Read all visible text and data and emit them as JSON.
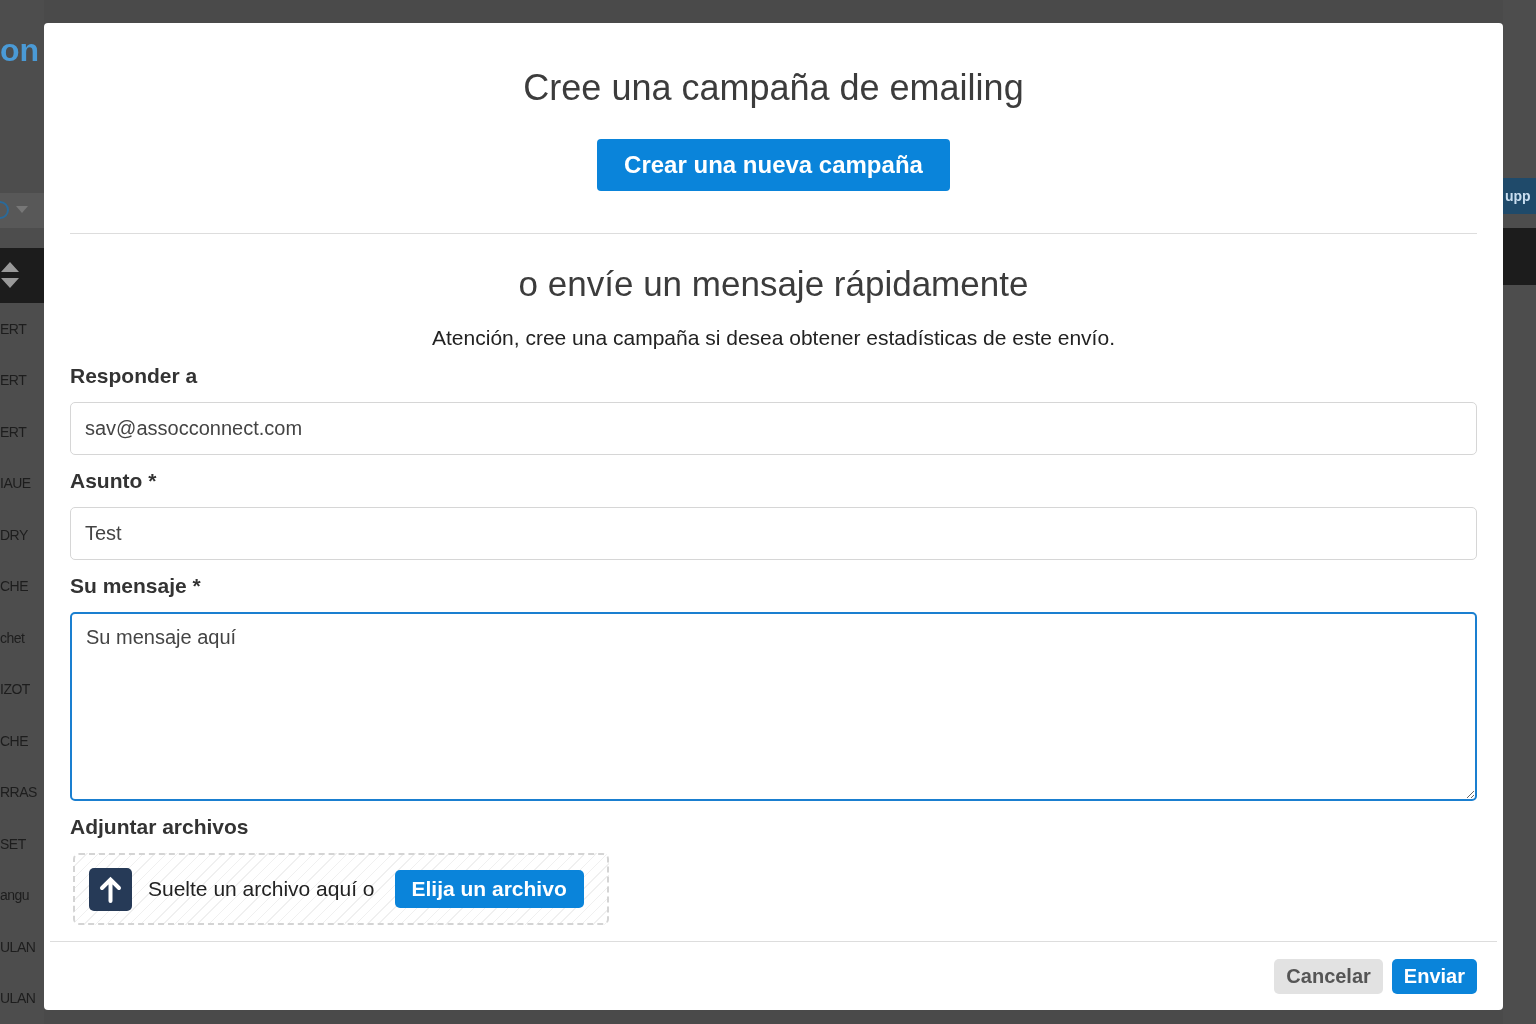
{
  "background": {
    "logo_fragment": "on",
    "selector_fragment": "upp",
    "rows": [
      "ERT",
      "ERT",
      "ERT",
      "IAUE",
      "DRY",
      "CHE",
      "chet",
      "IZOT",
      "CHE",
      "RRAS",
      "SET",
      "angu",
      "ULAN",
      "ULAN"
    ]
  },
  "dialog": {
    "title": "Cree una campaña de emailing",
    "primary_button": "Crear una nueva campaña",
    "subtitle": "o envíe un mensaje rápidamente",
    "notice": "Atención, cree una campaña si desea obtener estadísticas de este envío.",
    "fields": [
      {
        "kind": "input",
        "label": "Responder a",
        "value": "sav@assocconnect.com",
        "focused": false
      },
      {
        "kind": "input",
        "label": "Asunto *",
        "value": "Test",
        "focused": false
      },
      {
        "kind": "textarea",
        "label": "Su mensaje *",
        "placeholder": "Su mensaje aquí",
        "focused": true
      }
    ],
    "attachments": {
      "label": "Adjuntar archivos",
      "drop_text": "Suelte un archivo aquí o",
      "button": "Elija un archivo"
    },
    "footer": {
      "buttons": [
        {
          "label": "Cancelar",
          "kind": "secondary"
        },
        {
          "label": "Enviar",
          "kind": "primary"
        }
      ]
    }
  }
}
